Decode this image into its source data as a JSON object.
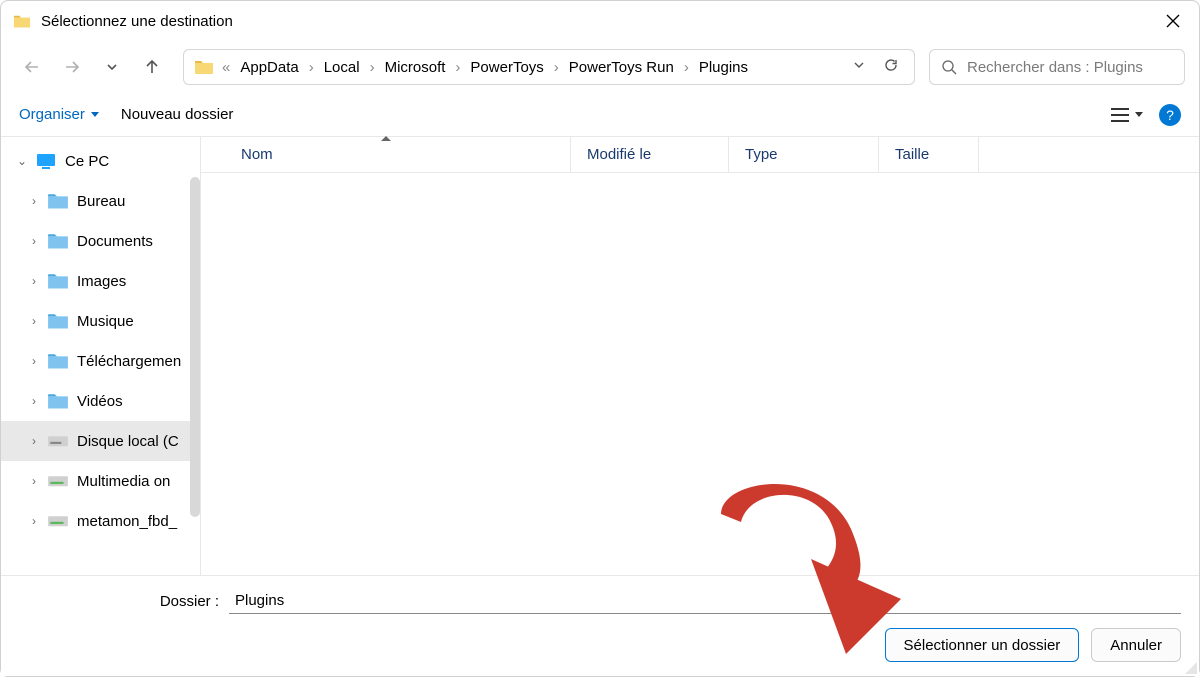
{
  "window": {
    "title": "Sélectionnez une destination"
  },
  "breadcrumbs": {
    "prefix": "«",
    "items": [
      "AppData",
      "Local",
      "Microsoft",
      "PowerToys",
      "PowerToys Run",
      "Plugins"
    ]
  },
  "search": {
    "placeholder": "Rechercher dans : Plugins"
  },
  "toolbar": {
    "organize": "Organiser",
    "newfolder": "Nouveau dossier",
    "help": "?"
  },
  "columns": {
    "name": "Nom",
    "modified": "Modifié le",
    "type": "Type",
    "size": "Taille"
  },
  "tree": {
    "root": "Ce PC",
    "items": [
      {
        "label": "Bureau",
        "icon": "folder"
      },
      {
        "label": "Documents",
        "icon": "folder"
      },
      {
        "label": "Images",
        "icon": "folder"
      },
      {
        "label": "Musique",
        "icon": "folder"
      },
      {
        "label": "Téléchargemen",
        "icon": "folder"
      },
      {
        "label": "Vidéos",
        "icon": "folder"
      },
      {
        "label": "Disque local (C",
        "icon": "drive",
        "selected": true
      },
      {
        "label": "Multimedia on",
        "icon": "netdrive"
      },
      {
        "label": "metamon_fbd_",
        "icon": "netdrive"
      }
    ]
  },
  "bottom": {
    "folder_label": "Dossier :",
    "folder_value": "Plugins",
    "select": "Sélectionner un dossier",
    "cancel": "Annuler"
  }
}
